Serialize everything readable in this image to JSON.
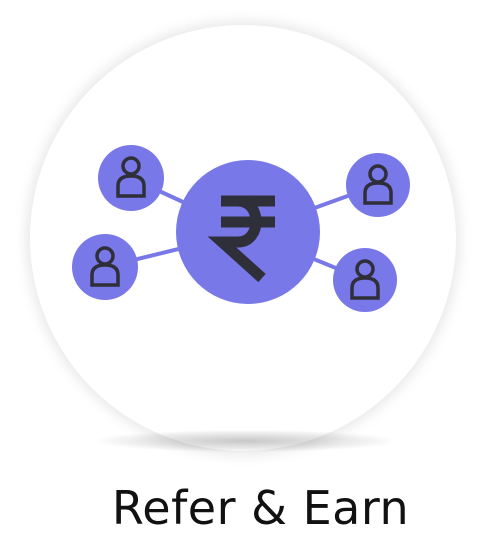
{
  "tile": {
    "label": "Refer & Earn",
    "center_symbol": "₹",
    "icon": "referral-network-icon"
  },
  "colors": {
    "node_fill": "#7878E8",
    "connector": "#7878E8",
    "glyph": "#2f2f3a",
    "background": "#ffffff"
  }
}
